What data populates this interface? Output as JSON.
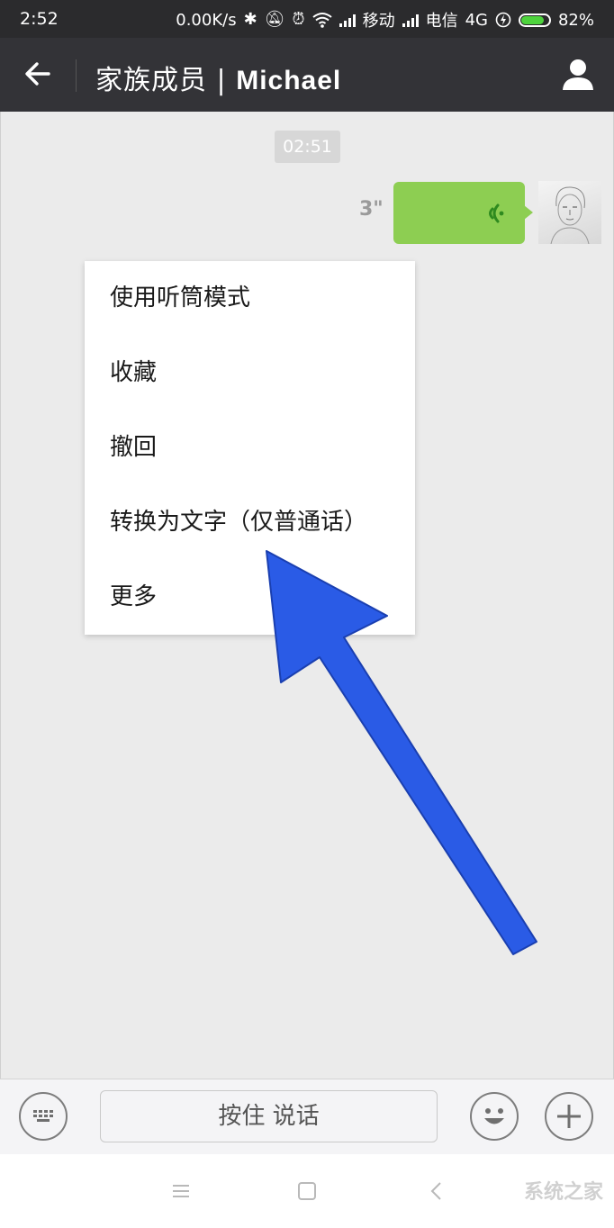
{
  "status_bar": {
    "time": "2:52",
    "speed": "0.00K/s",
    "carrier1": "移动",
    "carrier2": "电信",
    "network": "4G",
    "battery": "82%",
    "battery_level": 0.82
  },
  "header": {
    "title": "家族成员",
    "separator": "|",
    "name": "Michael",
    "back_icon": "arrow-left-icon",
    "profile_icon": "person-icon"
  },
  "chat": {
    "timestamp": "02:51",
    "voice_message": {
      "duration": "3\"",
      "color": "#8dce52"
    }
  },
  "context_menu": {
    "items": [
      {
        "label": "使用听筒模式"
      },
      {
        "label": "收藏"
      },
      {
        "label": "撤回"
      },
      {
        "label": "转换为文字（仅普通话）"
      },
      {
        "label": "更多"
      }
    ]
  },
  "annotation": {
    "color": "#2a5be6"
  },
  "input_bar": {
    "hold_to_talk": "按住 说话",
    "keyboard_icon": "keyboard-icon",
    "emoji_icon": "emoji-icon",
    "plus_icon": "plus-icon"
  },
  "watermark": "系统之家"
}
